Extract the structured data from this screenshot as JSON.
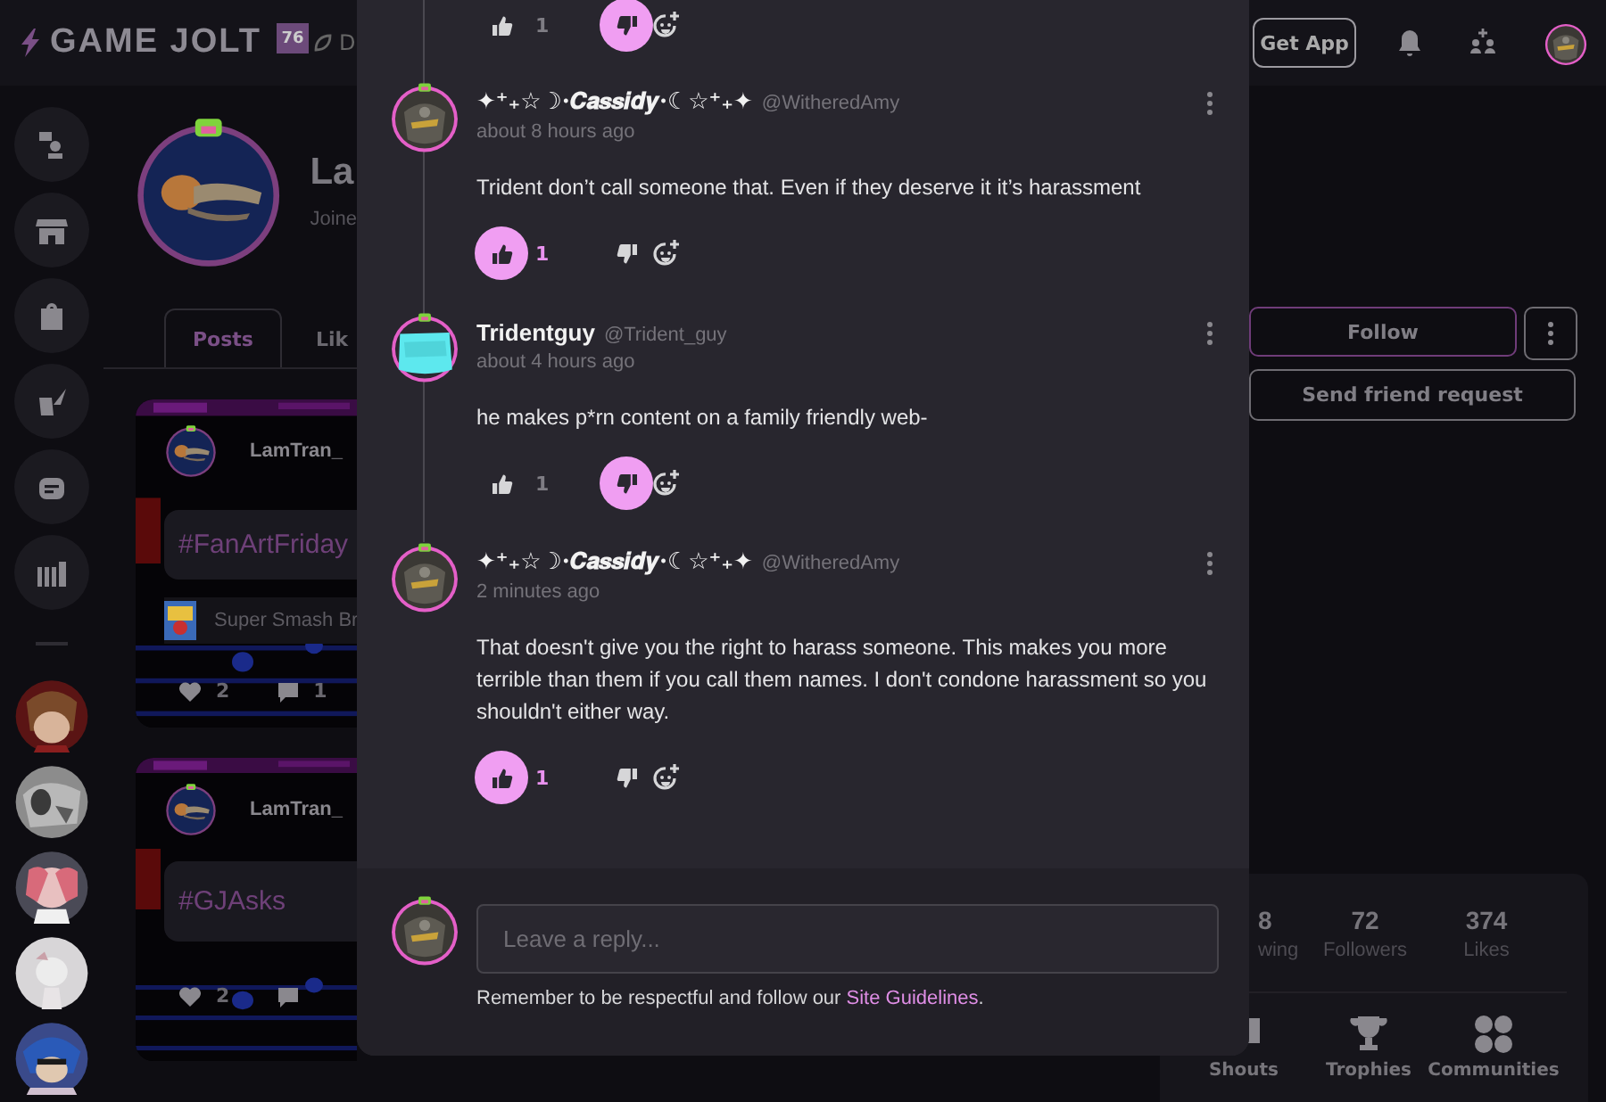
{
  "topbar": {
    "logo": "GAME JOLT",
    "badge": "76",
    "nav_items": [
      {
        "label": "D"
      }
    ],
    "get_app": "Get App"
  },
  "profile": {
    "name": "La",
    "joined": "Joine",
    "tabs": [
      {
        "label": "Posts",
        "selected": true
      },
      {
        "label": "Lik",
        "selected": false
      }
    ]
  },
  "posts": [
    {
      "author": "LamTran_",
      "tag": "#FanArtFriday",
      "game": "Super Smash Br",
      "likes": "2",
      "comments": "1"
    },
    {
      "author": "LamTran_",
      "tag": "#GJAsks",
      "likes": "2"
    }
  ],
  "profile_actions": {
    "follow": "Follow",
    "friend_request": "Send friend request"
  },
  "stats": [
    {
      "value": "8",
      "label": "wing"
    },
    {
      "value": "72",
      "label": "Followers"
    },
    {
      "value": "374",
      "label": "Likes"
    }
  ],
  "sections": [
    {
      "label": "Shouts",
      "kind": "shouts"
    },
    {
      "label": "Trophies",
      "kind": "trophies"
    },
    {
      "label": "Communities",
      "kind": "communities"
    }
  ],
  "comments_panel": {
    "previous_actions": {
      "likes": "1",
      "liked": false,
      "disliked": true
    },
    "comments": [
      {
        "name": "✦⁺₊☆☽·𝑪𝒂𝒔𝒔𝒊𝒅𝒚·☾☆⁺₊✦",
        "handle": "@WitheredAmy",
        "time": "about 8 hours ago",
        "body": "Trident don’t call someone that. Even if they deserve it it’s harassment",
        "likes": "1",
        "liked": true,
        "disliked": false
      },
      {
        "name": "Tridentguy",
        "handle": "@Trident_guy",
        "time": "about 4 hours ago",
        "body": "he makes p*rn content on a family friendly web-",
        "likes": "1",
        "liked": false,
        "disliked": true
      },
      {
        "name": "✦⁺₊☆☽·𝑪𝒂𝒔𝒔𝒊𝒅𝒚·☾☆⁺₊✦",
        "handle": "@WitheredAmy",
        "time": "2 minutes ago",
        "body": "That doesn't give you the right to harass someone. This makes you more terrible than them if you call them names. I don't condone harassment so you shouldn't either way.",
        "likes": "1",
        "liked": true,
        "disliked": false
      }
    ],
    "reply": {
      "placeholder": "Leave a reply...",
      "note": "Remember to be respectful and follow our ",
      "link": "Site Guidelines",
      "note_end": "."
    }
  }
}
